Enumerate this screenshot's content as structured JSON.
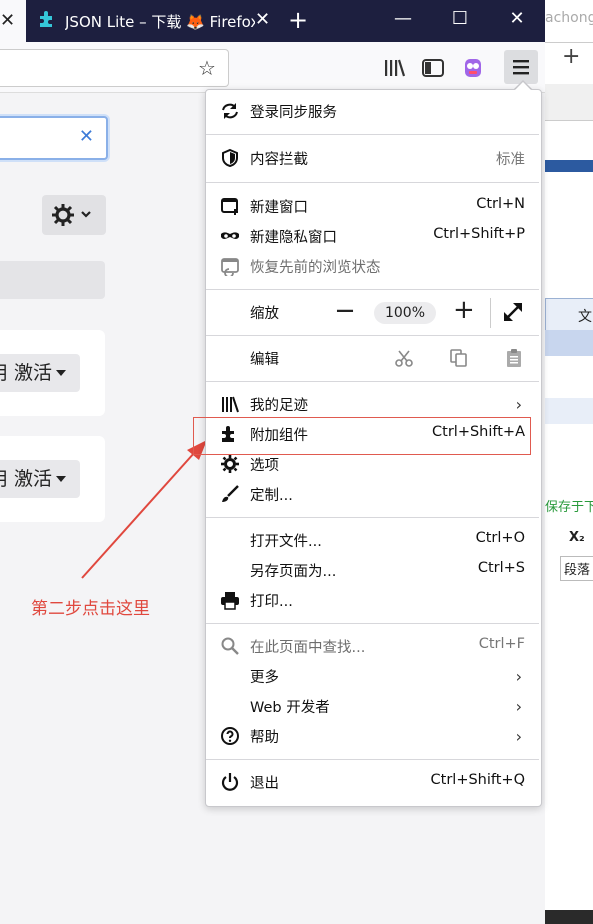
{
  "tabs": {
    "active_close": "✕",
    "second_title": "JSON Lite – 下载 🦊 Firefox",
    "second_close": "✕",
    "new_tab": "+"
  },
  "window": {
    "minimize": "—",
    "maximize": "☐",
    "close": "✕"
  },
  "right_window": {
    "top_text": "achong",
    "plus": "+",
    "tab_label": "文",
    "save_text": "保存于下",
    "format_label": "段落",
    "subscript": "X₂"
  },
  "page": {
    "search_clear": "✕",
    "card1_button": "禁用 激活",
    "card2_button": "禁用 激活",
    "annotation": "第二步点击这里"
  },
  "menu": {
    "sync": "登录同步服务",
    "content_blocking": "内容拦截",
    "content_blocking_value": "标准",
    "new_window": "新建窗口",
    "new_window_shortcut": "Ctrl+N",
    "new_private": "新建隐私窗口",
    "new_private_shortcut": "Ctrl+Shift+P",
    "restore": "恢复先前的浏览状态",
    "zoom": "缩放",
    "zoom_minus": "—",
    "zoom_value": "100%",
    "zoom_plus": "+",
    "edit": "编辑",
    "library": "我的足迹",
    "addons": "附加组件",
    "addons_shortcut": "Ctrl+Shift+A",
    "options": "选项",
    "customize": "定制...",
    "open_file": "打开文件...",
    "open_file_shortcut": "Ctrl+O",
    "save_page": "另存页面为...",
    "save_page_shortcut": "Ctrl+S",
    "print": "打印...",
    "find": "在此页面中查找...",
    "find_shortcut": "Ctrl+F",
    "more": "更多",
    "web_dev": "Web 开发者",
    "help": "帮助",
    "quit": "退出",
    "quit_shortcut": "Ctrl+Shift+Q",
    "chevron": "›"
  },
  "colors": {
    "titlebar": "#1d1f3f",
    "highlight": "#e05a4f",
    "accent": "#3d7bd8"
  }
}
